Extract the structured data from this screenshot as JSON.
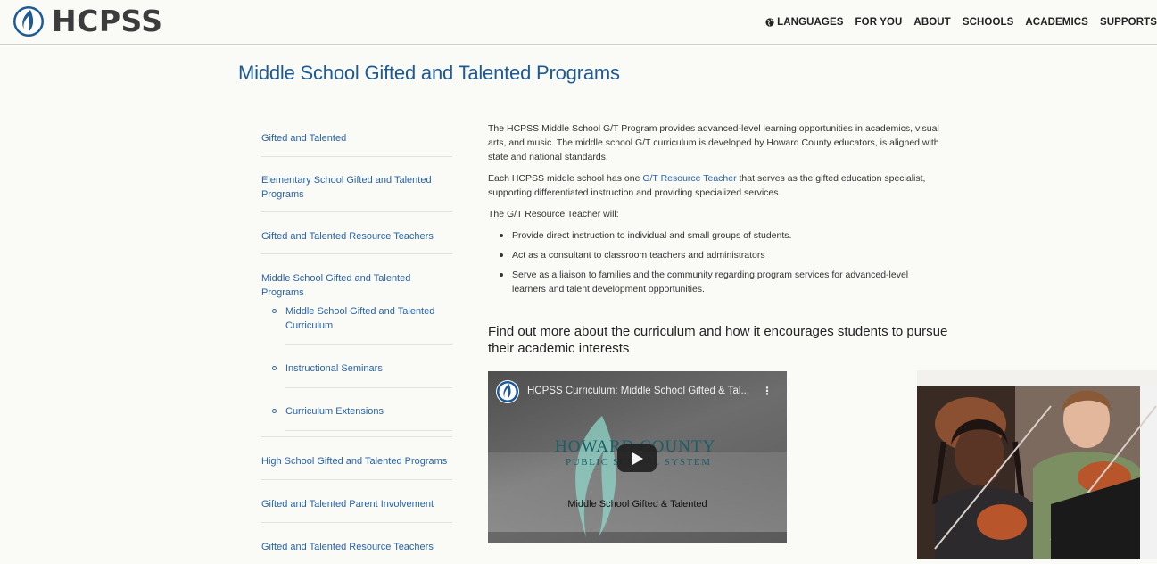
{
  "header": {
    "logo_text": "HCPSS",
    "nav": [
      {
        "label": "LANGUAGES",
        "icon": "globe-icon"
      },
      {
        "label": "FOR YOU"
      },
      {
        "label": "ABOUT"
      },
      {
        "label": "SCHOOLS"
      },
      {
        "label": "ACADEMICS"
      },
      {
        "label": "SUPPORTS"
      }
    ]
  },
  "page": {
    "title": "Middle School Gifted and Talented Programs"
  },
  "sidebar": {
    "items": [
      {
        "label": "Gifted and Talented"
      },
      {
        "label": "Elementary School Gifted and Talented Programs"
      },
      {
        "label": "Gifted and Talented Resource Teachers"
      },
      {
        "label": "Middle School Gifted and Talented Programs"
      },
      {
        "label": "High School Gifted and Talented Programs"
      },
      {
        "label": "Gifted and Talented Parent Involvement"
      },
      {
        "label": "Gifted and Talented Resource Teachers"
      }
    ],
    "subitems": [
      {
        "label": "Middle School Gifted and Talented Curriculum"
      },
      {
        "label": "Instructional Seminars"
      },
      {
        "label": "Curriculum Extensions"
      }
    ]
  },
  "content": {
    "para1": "The HCPSS Middle School G/T Program provides advanced-level learning opportunities in academics, visual arts, and music. The middle school G/T curriculum is developed by Howard County educators, is aligned with state and national standards.",
    "para2_before": "Each HCPSS middle school has one ",
    "para2_link": "G/T Resource Teacher",
    "para2_after": " that serves as the gifted education specialist, supporting differentiated instruction and providing specialized services.",
    "para3": "The G/T Resource Teacher will:",
    "bullets": [
      "Provide direct instruction to individual and small groups of students.",
      "Act as a consultant to classroom teachers and administrators",
      "Serve as a liaison to families and the community regarding program services for advanced-level learners and talent development opportunities."
    ],
    "subheading": "Find out more about the curriculum and how it encourages students to pursue their academic interests"
  },
  "video": {
    "title": "HCPSS Curriculum: Middle School Gifted & Tal...",
    "menu_icon": "more-vert-icon",
    "howard": "HOWARD COUNTY",
    "public": "PUBLIC SCHOOL SYSTEM",
    "caption": "Middle School Gifted & Talented"
  },
  "colors": {
    "link": "#2a63a6",
    "title": "#1d5a96",
    "background": "#fafaf7"
  }
}
